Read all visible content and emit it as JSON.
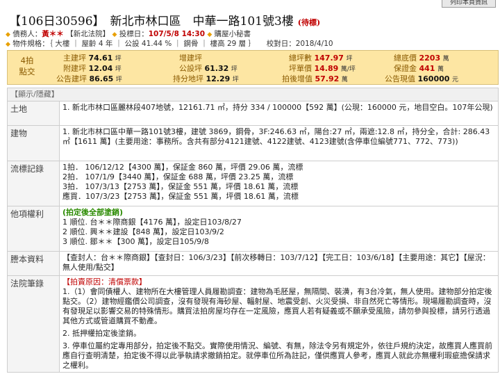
{
  "print_button": "列印本頁資訊",
  "case_no": "【106日30596】",
  "address": "新北市林口區　中華一路101號3樓",
  "status": "(待標)",
  "info1": {
    "debtor_label": "債務人：",
    "debtor": "黃＊＊",
    "court": "【新北法院】",
    "date_label": "投標日：",
    "date": "107/5/8 14:30",
    "helper": "購屋小秘書"
  },
  "info2": "物件規格：｛ 大樓 ｜ 屋齡 4 年 ｜ 公設 41.44 % ｜ 鋼骨 ｜ 樓高 29 層 ｝　　校對日：2018/4/10",
  "summary": {
    "label": "4拍\n點交",
    "main_area_k": "主建坪",
    "main_area_v": "74.61",
    "main_area_u": "坪",
    "attach_k": "附建坪",
    "attach_v": "12.04",
    "attach_u": "坪",
    "common_k": "公告建坪",
    "common_v": "86.65",
    "common_u": "坪",
    "add_k": "增建坪",
    "add_v": "",
    "public_k": "公設坪",
    "public_v": "61.32",
    "public_u": "坪",
    "land_k": "持分地坪",
    "land_v": "12.29",
    "land_u": "坪",
    "total_k": "總坪數",
    "total_v": "147.97",
    "total_u": "坪",
    "unit_k": "坪單價",
    "unit_v": "14.89",
    "unit_u": "萬/坪",
    "rise_k": "拍後增值",
    "rise_v": "57.92",
    "rise_u": "萬",
    "base_k": "總底價",
    "base_v": "2203",
    "base_u": "萬",
    "deposit_k": "保證金",
    "deposit_v": "441",
    "deposit_u": "萬",
    "announce_k": "公告現值",
    "announce_v": "160000",
    "announce_u": "元"
  },
  "table": {
    "header": "【顯示/隱藏】",
    "land_h": "土地",
    "land": "1. 新北市林口區麗林段407地號，12161.71 ㎡，持分 334 / 100000【592 萬】(公現：160000 元，地目空白。107年公現)",
    "building_h": "建物",
    "building": "1. 新北市林口區中華一路101號3樓，建號 3869，鋼骨，3F:246.63 ㎡，陽台:27 ㎡，兩遮:12.8 ㎡，持分全，合計: 286.43 ㎡【1611 萬】(主要用途：事務所。含共有部分4121建號、4122建號、4123建號(含停車位編號771、772、773))",
    "flow_h": "流標記錄",
    "flow": [
      "1拍．  106/12/12【4300 萬】，保証金 860 萬，坪價 29.06 萬，流標",
      "2拍．  107/1/9【3440 萬】，保証金 688 萬，坪價 23.25 萬，流標",
      "3拍．  107/3/13【2753 萬】，保証金 551 萬，坪價 18.61 萬，流標",
      "應買．107/3/23【2753 萬】，保証金 551 萬，坪價 18.61 萬，流標"
    ],
    "rights_h": "他項權利",
    "rights_note": "(拍定後全部塗銷)",
    "rights": [
      "1 順位. 台＊＊際商銀【4176 萬】，設定日103/8/27",
      "2 順位. 興＊＊建設【848 萬】，設定日103/9/2",
      "3 順位. 鄒＊＊【300 萬】，設定日105/9/8"
    ],
    "lease_h": "謄本資料",
    "lease": "【查封人：台＊＊際商銀】【查封日：106/3/23】【前次移轉日：103/7/12】【完工日：103/6/18】【主要用途：其它】【屋況：無人使用/點交】",
    "notes_h": "法院筆錄",
    "notes_reason": "【拍賣原因：清償票款】",
    "notes": [
      "1.（1）會同債權人、建物所在大樓管理人員履勘調查：建物為毛胚屋，無隔間、裝潢，有3台冷氣，無人使用。建物部分拍定後點交。（2）建物經鑑價公司調查，沒有發現有海砂屋、輻射屋、地震受創、火災受損、非自然死亡等情形。現場履勘調查時，沒有發現足以影響交易的特殊情形。購買法拍房屋均存在一定風險，應買人若有疑義或不願承受風險，請勿參與投標，請另行透過其他方式或管道購買不動產。",
      "2. 抵押權拍定後塗銷。",
      "3. 停車位屬約定專用部分，拍定後不點交。實際使用情況、編號、有無，除法令另有規定外，依往戶規約決定，故應買人應買前應自行查明清楚，拍定後不得以此爭執請求撤銷拍定。就停車位所為註記，僅供應買人參考，應買人就此亦無權利瑕疵擔保請求之權利。"
    ]
  }
}
